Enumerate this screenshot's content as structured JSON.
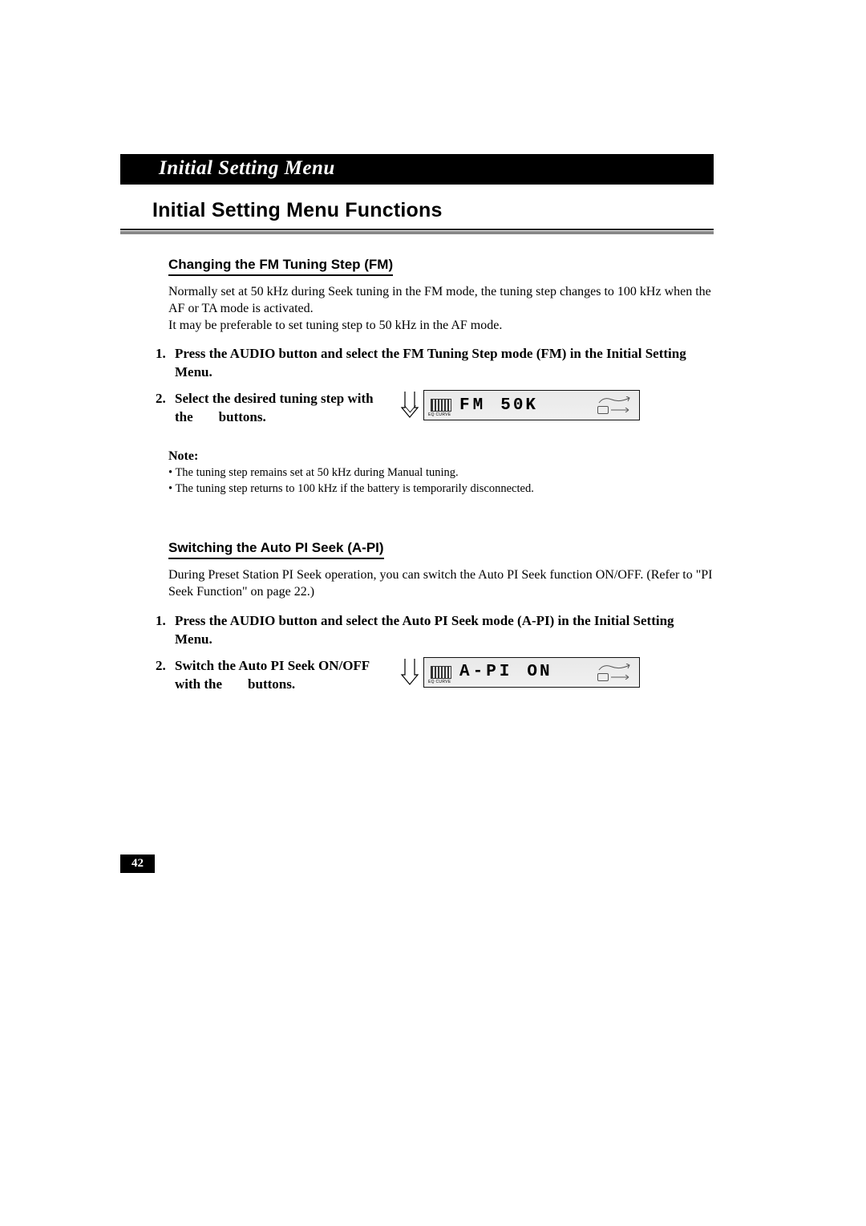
{
  "banner": {
    "title": "Initial Setting Menu"
  },
  "h1": "Initial Setting Menu Functions",
  "section1": {
    "heading": "Changing the FM Tuning Step (FM)",
    "para1": "Normally set at 50 kHz during Seek tuning in the FM mode, the tuning step changes to 100 kHz when the AF or TA mode is activated.",
    "para2": "It may be preferable to set tuning step to 50 kHz in the AF mode.",
    "step1_num": "1.",
    "step1": "Press the AUDIO button and select the FM Tuning Step mode (FM) in the Initial Setting Menu.",
    "step2_num": "2.",
    "step2_a": "Select the desired tuning step with the",
    "step2_b": "buttons.",
    "lcd_mode": "FM",
    "lcd_value": "50K",
    "note_label": "Note:",
    "note1": "The tuning step remains set at 50 kHz during Manual tuning.",
    "note2": "The tuning step returns to 100 kHz if the battery is temporarily disconnected."
  },
  "section2": {
    "heading": "Switching the Auto PI Seek (A-PI)",
    "para1": "During Preset Station PI Seek operation, you can switch the Auto PI Seek function ON/OFF. (Refer to \"PI Seek Function\" on page 22.)",
    "step1_num": "1.",
    "step1": "Press the AUDIO button and select the Auto PI Seek mode (A-PI) in the Initial Setting Menu.",
    "step2_num": "2.",
    "step2_a": "Switch the Auto PI Seek ON/OFF with the",
    "step2_b": "buttons.",
    "lcd_mode": "A-PI",
    "lcd_value": "ON"
  },
  "page_number": "42",
  "icons": {
    "eq_label": "EQ CURVE"
  }
}
